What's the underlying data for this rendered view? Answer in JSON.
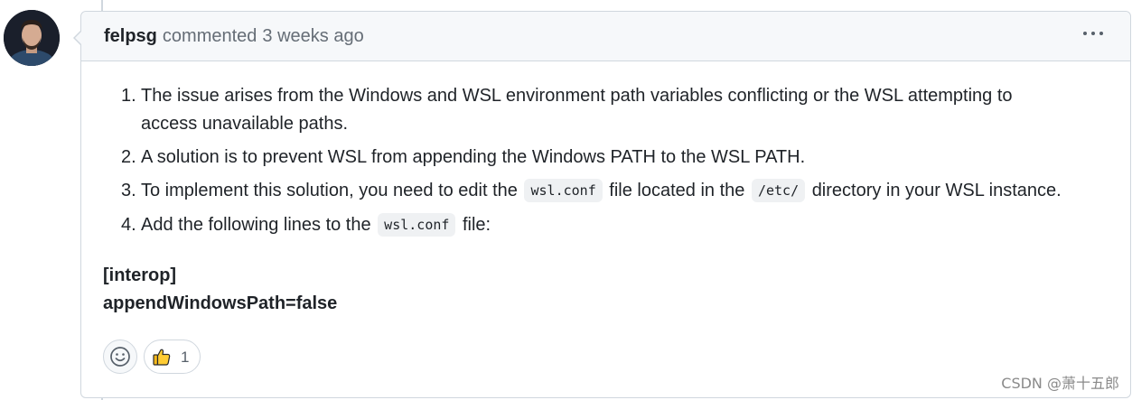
{
  "comment": {
    "author": "felpsg",
    "action": "commented",
    "time": "3 weeks ago",
    "menu_icon": "kebab-horizontal-icon"
  },
  "body": {
    "list": [
      {
        "number": "1.",
        "line1": "The issue arises from the Windows and WSL environment path variables conflicting or the WSL attempting to",
        "line2": "access unavailable paths."
      },
      {
        "number": "2.",
        "text": "A solution is to prevent WSL from appending the Windows PATH to the WSL PATH."
      },
      {
        "number": "3.",
        "part1": "To implement this solution, you need to edit the",
        "code1": "wsl.conf",
        "part2": "file located in the",
        "code2": "/etc/",
        "part3": "directory in your WSL instance."
      },
      {
        "number": "4.",
        "part1": "Add the following lines to the",
        "code1": "wsl.conf",
        "part2": "file:"
      }
    ],
    "code_block": {
      "line1": "[interop]",
      "line2": "appendWindowsPath=false"
    }
  },
  "reactions": {
    "add_icon": "smiley-icon",
    "items": [
      {
        "emoji_icon": "thumbs-up-icon",
        "count": "1"
      }
    ]
  },
  "watermark": "CSDN @萧十五郎"
}
